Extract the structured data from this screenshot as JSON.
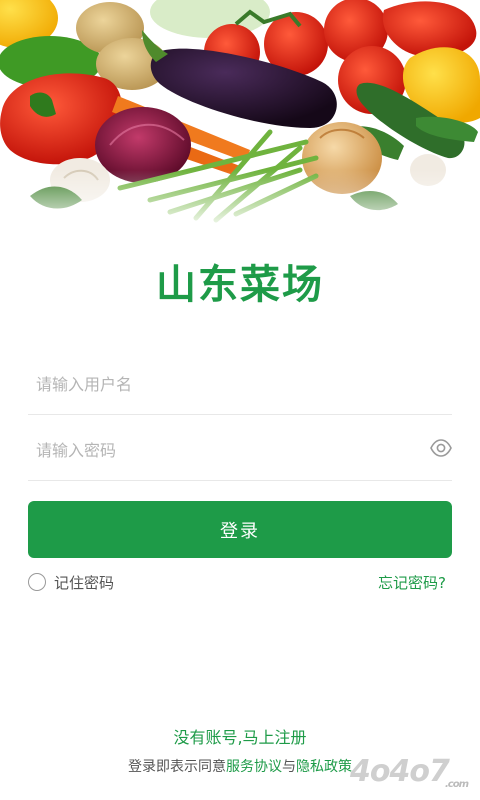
{
  "app": {
    "title": "山东菜场"
  },
  "login_form": {
    "username_placeholder": "请输入用户名",
    "password_placeholder": "请输入密码",
    "login_label": "登录",
    "remember_label": "记住密码",
    "forgot_label": "忘记密码?"
  },
  "footer": {
    "register_label": "没有账号,马上注册",
    "agreement_prefix": "登录即表示同意",
    "service_agreement": "服务协议",
    "conjunction": "与",
    "privacy_policy": "隐私政策"
  },
  "icons": {
    "password_visibility": "eye-icon",
    "remember_radio": "radio-circle"
  },
  "colors": {
    "accent": "#1e9b48",
    "placeholder": "#b5b5b5",
    "text": "#555555"
  }
}
